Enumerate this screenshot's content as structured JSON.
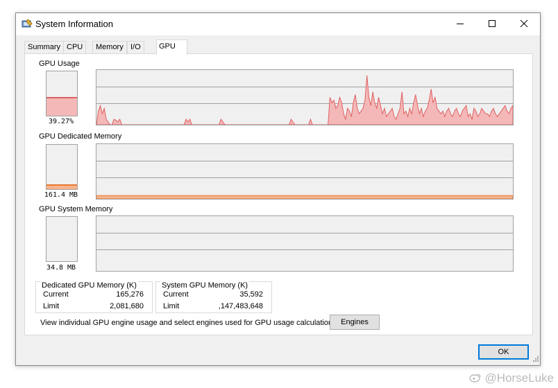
{
  "window": {
    "title": "System Information",
    "controls": {
      "minimize": "minimize-icon",
      "maximize": "maximize-icon",
      "close": "close-icon"
    }
  },
  "tabs": [
    {
      "label": "Summary",
      "active": false
    },
    {
      "label": "CPU",
      "active": false
    },
    {
      "label": "Memory",
      "active": false
    },
    {
      "label": "I/O",
      "active": false
    },
    {
      "label": "GPU",
      "active": true
    }
  ],
  "gpu_usage": {
    "label": "GPU Usage",
    "value_text": "39.27%",
    "meter_fraction": 0.3927,
    "history_fraction": [
      0,
      0.25,
      0.35,
      0.2,
      0.3,
      0.1,
      0.05,
      0,
      0,
      0.1,
      0.08,
      0.05,
      0.1,
      0,
      0,
      0,
      0,
      0,
      0,
      0,
      0,
      0,
      0,
      0,
      0,
      0,
      0,
      0,
      0,
      0,
      0,
      0,
      0,
      0,
      0,
      0,
      0,
      0,
      0,
      0,
      0,
      0,
      0,
      0,
      0,
      0,
      0.1,
      0.05,
      0.1,
      0,
      0,
      0,
      0,
      0,
      0,
      0,
      0,
      0,
      0,
      0,
      0,
      0,
      0,
      0,
      0.1,
      0.05,
      0,
      0,
      0,
      0,
      0,
      0,
      0,
      0,
      0,
      0,
      0,
      0,
      0,
      0,
      0,
      0,
      0,
      0,
      0,
      0,
      0,
      0,
      0,
      0,
      0,
      0,
      0,
      0,
      0,
      0,
      0,
      0,
      0,
      0,
      0.1,
      0.05,
      0,
      0,
      0,
      0,
      0,
      0,
      0,
      0,
      0.1,
      0,
      0,
      0,
      0,
      0,
      0,
      0,
      0,
      0,
      0.5,
      0.4,
      0.45,
      0.3,
      0.35,
      0.5,
      0.4,
      0.2,
      0.1,
      0.3,
      0.25,
      0.15,
      0.4,
      0.55,
      0.3,
      0.2,
      0.25,
      0.3,
      0.45,
      0.9,
      0.5,
      0.35,
      0.6,
      0.4,
      0.3,
      0.5,
      0.35,
      0.2,
      0.3,
      0.15,
      0.2,
      0.25,
      0.3,
      0.15,
      0.1,
      0.2,
      0.3,
      0.6,
      0.2,
      0.25,
      0.15,
      0.3,
      0.2,
      0.4,
      0.55,
      0.35,
      0.2,
      0.3,
      0.15,
      0.25,
      0.3,
      0.45,
      0.65,
      0.4,
      0.5,
      0.3,
      0.25,
      0.2,
      0.25,
      0.15,
      0.25,
      0.3,
      0.2,
      0.15,
      0.25,
      0.3,
      0.2,
      0.15,
      0.25,
      0.3,
      0.35,
      0.15,
      0.2,
      0.1,
      0.3,
      0.25,
      0.15,
      0.2,
      0.3,
      0.25,
      0.2,
      0.2,
      0.15,
      0.25,
      0.3,
      0.2,
      0.15,
      0.2,
      0.25,
      0.3,
      0.35,
      0.25,
      0.2,
      0.3,
      0.35
    ]
  },
  "gpu_dedicated": {
    "label": "GPU Dedicated Memory",
    "value_text": "161.4 MB",
    "meter_fraction": 0.08,
    "history_fraction": 0.06
  },
  "gpu_system": {
    "label": "GPU System Memory",
    "value_text": "34.8 MB",
    "meter_fraction": 0.0,
    "history_fraction": 0.0
  },
  "dedicated_group": {
    "title": "Dedicated GPU Memory (K)",
    "rows": [
      {
        "label": "Current",
        "value": "165,276"
      },
      {
        "label": "Limit",
        "value": "2,081,680"
      }
    ]
  },
  "system_group": {
    "title": "System GPU Memory (K)",
    "rows": [
      {
        "label": "Current",
        "value": "35,592"
      },
      {
        "label": "Limit",
        "value": ",147,483,648"
      }
    ]
  },
  "engines": {
    "description": "View individual GPU engine usage and select engines used for GPU usage calculations:",
    "button": "Engines"
  },
  "ok_button": "OK",
  "watermark": "@HorseLuke",
  "colors": {
    "usage_fill": "#f4b8b8",
    "usage_line": "#e06060",
    "memory_fill": "#f7b48a",
    "memory_line": "#e87a3a",
    "focus": "#0078d7"
  }
}
